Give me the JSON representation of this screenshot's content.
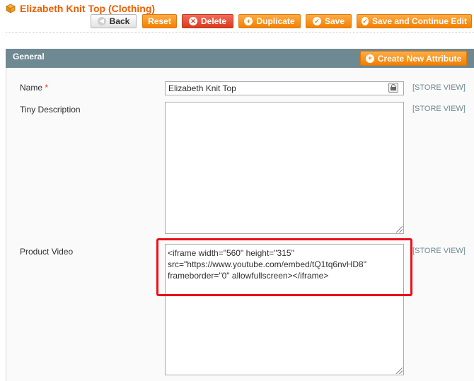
{
  "header": {
    "title": "Elizabeth Knit Top (Clothing)",
    "buttons": {
      "back": "Back",
      "reset": "Reset",
      "delete": "Delete",
      "duplicate": "Duplicate",
      "save": "Save",
      "save_continue": "Save and Continue Edit"
    }
  },
  "panel": {
    "title": "General",
    "create_attribute": "Create New Attribute"
  },
  "fields": {
    "name": {
      "label": "Name",
      "required": "*",
      "value": "Elizabeth Knit Top",
      "scope": "[STORE VIEW]"
    },
    "tiny_description": {
      "label": "Tiny Description",
      "value": "",
      "scope": "[STORE VIEW]"
    },
    "product_video": {
      "label": "Product Video",
      "value": "<iframe width=\"560\" height=\"315\"\nsrc=\"https://www.youtube.com/embed/tQ1tq6nvHD8\"\nframeborder=\"0\" allowfullscreen></iframe>",
      "scope": "[STORE VIEW]"
    }
  },
  "colors": {
    "accent_orange": "#f28000",
    "title_orange": "#eb5e00",
    "panel_header": "#6f8992",
    "delete_red": "#db3a1a",
    "highlight_red": "#e8101b"
  },
  "icons": [
    "product-box-icon",
    "back-arrow-icon",
    "delete-x-icon",
    "plus-icon",
    "checkmark-icon",
    "lock-icon"
  ]
}
